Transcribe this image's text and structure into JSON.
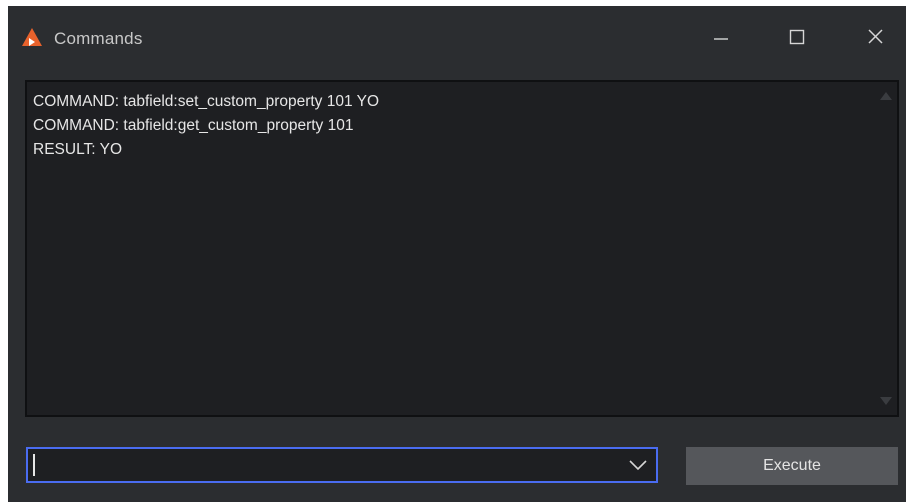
{
  "window": {
    "title": "Commands",
    "controls": {
      "minimize": "minimize-icon",
      "maximize": "maximize-icon",
      "close": "close-icon"
    }
  },
  "output": {
    "lines": [
      "COMMAND: tabfield:set_custom_property 101 YO",
      "COMMAND: tabfield:get_custom_property 101",
      "RESULT: YO"
    ]
  },
  "command_input": {
    "value": "",
    "placeholder": ""
  },
  "execute_button": {
    "label": "Execute"
  },
  "colors": {
    "window_bg": "#2b2d30",
    "output_bg": "#1e1f22",
    "focus_border": "#4a6cf0",
    "button_bg": "#55575b",
    "icon_orange": "#e8622c"
  }
}
